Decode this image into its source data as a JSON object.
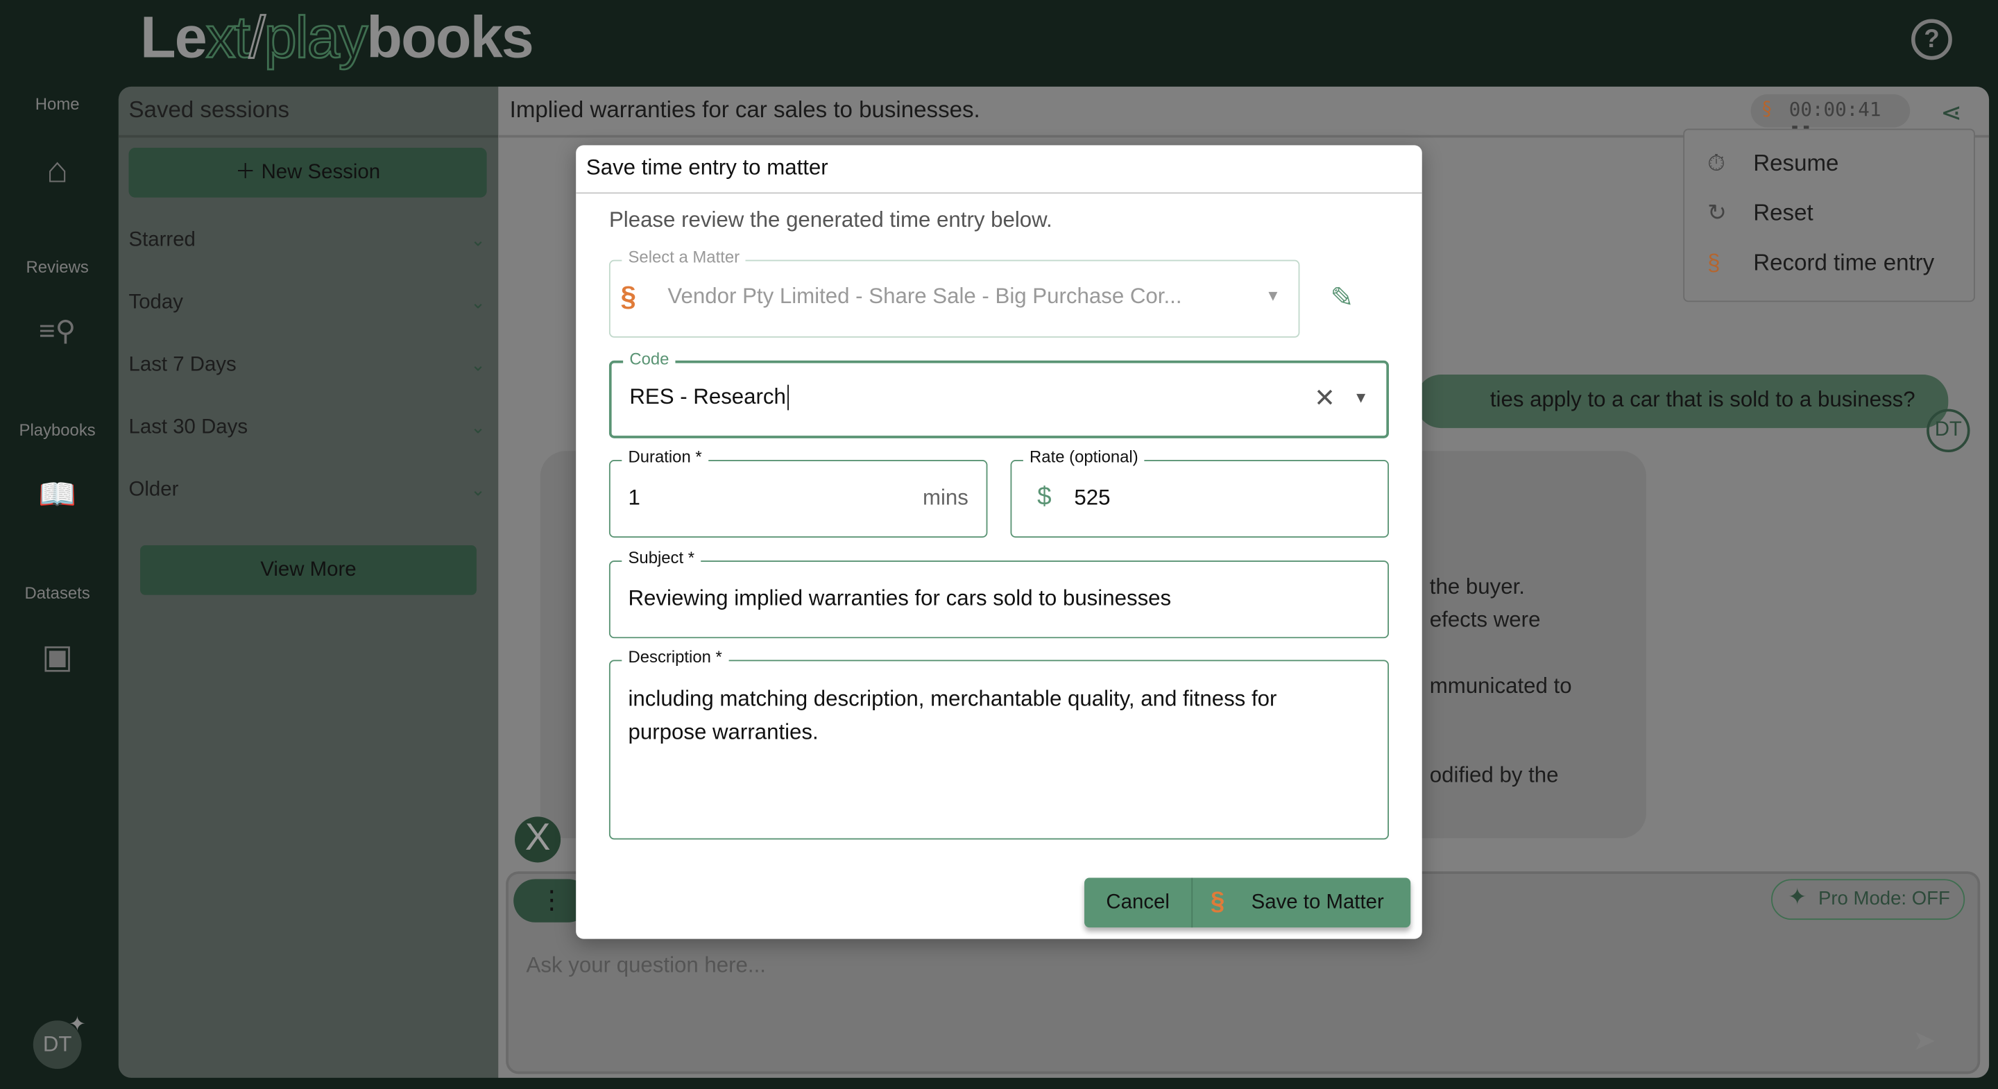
{
  "app": {
    "logo_text": "Lext/playbooks",
    "logo_parts": [
      "Le",
      "xt",
      "/",
      "play",
      "books"
    ],
    "help_icon": "question-circle-icon"
  },
  "nav": [
    {
      "label": "Home",
      "icon": "home-icon"
    },
    {
      "label": "Reviews",
      "icon": "search-list-icon"
    },
    {
      "label": "Playbooks",
      "icon": "book-icon"
    },
    {
      "label": "Datasets",
      "icon": "archive-icon"
    }
  ],
  "user": {
    "initials": "DT"
  },
  "sessions": {
    "title": "Saved sessions",
    "new_session": "New Session",
    "groups": [
      "Starred",
      "Today",
      "Last 7 Days",
      "Last 30 Days",
      "Older"
    ],
    "view_more": "View More"
  },
  "chat": {
    "title": "Implied warranties for car sales to businesses.",
    "timer": "00:00:41",
    "timer_menu": [
      {
        "label": "Resume",
        "icon": "stopwatch-icon"
      },
      {
        "label": "Reset",
        "icon": "reset-icon"
      },
      {
        "label": "Record time entry",
        "icon": "smokeball-icon"
      }
    ],
    "user_message_fragment": "ties apply to a car that is sold to a business?",
    "response_fragments": [
      "the buyer.",
      "efects were",
      "mmunicated to",
      "odified by the"
    ],
    "input_placeholder": "Ask your question here...",
    "pro_mode": "Pro Mode: OFF"
  },
  "modal": {
    "title": "Save time entry to matter",
    "intro": "Please review the generated time entry below.",
    "matter": {
      "label": "Select a Matter",
      "value": "Vendor Pty Limited - Share Sale - Big Purchase Cor..."
    },
    "code": {
      "label": "Code",
      "value": "RES - Research"
    },
    "duration": {
      "label": "Duration *",
      "value": "1",
      "unit": "mins"
    },
    "rate": {
      "label": "Rate (optional)",
      "currency": "$",
      "value": "525"
    },
    "subject": {
      "label": "Subject *",
      "value": "Reviewing implied warranties for cars sold to businesses"
    },
    "description": {
      "label": "Description *",
      "value": "including matching description, merchantable quality, and fitness for purpose warranties."
    },
    "cancel": "Cancel",
    "save": "Save to Matter"
  },
  "colors": {
    "accent": "#5a9474",
    "brand_dark": "#2d4a3a",
    "smokeball_orange": "#e07b39"
  }
}
